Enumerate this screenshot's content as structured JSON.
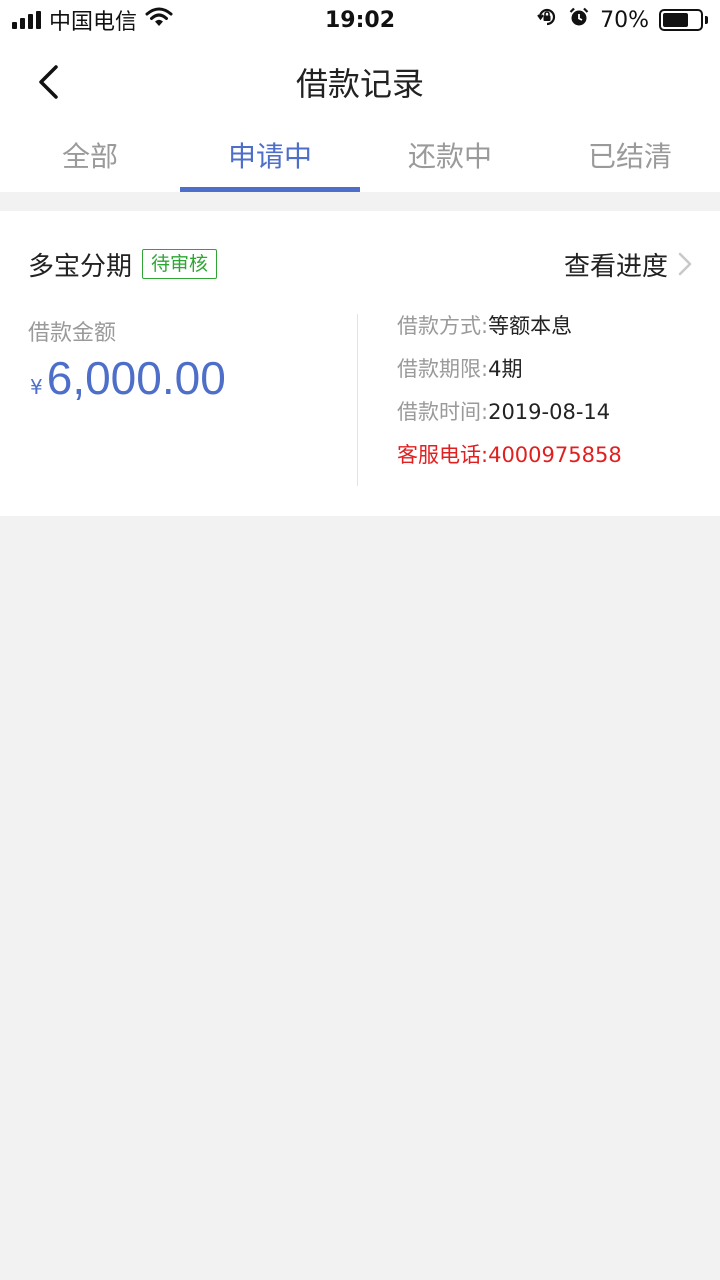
{
  "status_bar": {
    "carrier": "中国电信",
    "time": "19:02",
    "battery": "70%",
    "battery_level": 0.7
  },
  "nav": {
    "title": "借款记录",
    "back_icon": "chevron-left-icon"
  },
  "tabs": [
    {
      "label": "全部",
      "active": false
    },
    {
      "label": "申请中",
      "active": true
    },
    {
      "label": "还款中",
      "active": false
    },
    {
      "label": "已结清",
      "active": false
    }
  ],
  "loan": {
    "product": "多宝分期",
    "status": "待审核",
    "progress_label": "查看进度",
    "amount_label": "借款金额",
    "currency": "¥",
    "amount": "6,000.00",
    "details": [
      {
        "key": "借款方式:",
        "value": "等额本息"
      },
      {
        "key": "借款期限:",
        "value": "4期"
      },
      {
        "key": "借款时间:",
        "value": "2019-08-14"
      }
    ],
    "hotline": {
      "key": "客服电话:",
      "value": "4000975858"
    }
  },
  "colors": {
    "accent": "#4e6fc9",
    "badge": "#2fa634",
    "hotline": "#e02020"
  }
}
